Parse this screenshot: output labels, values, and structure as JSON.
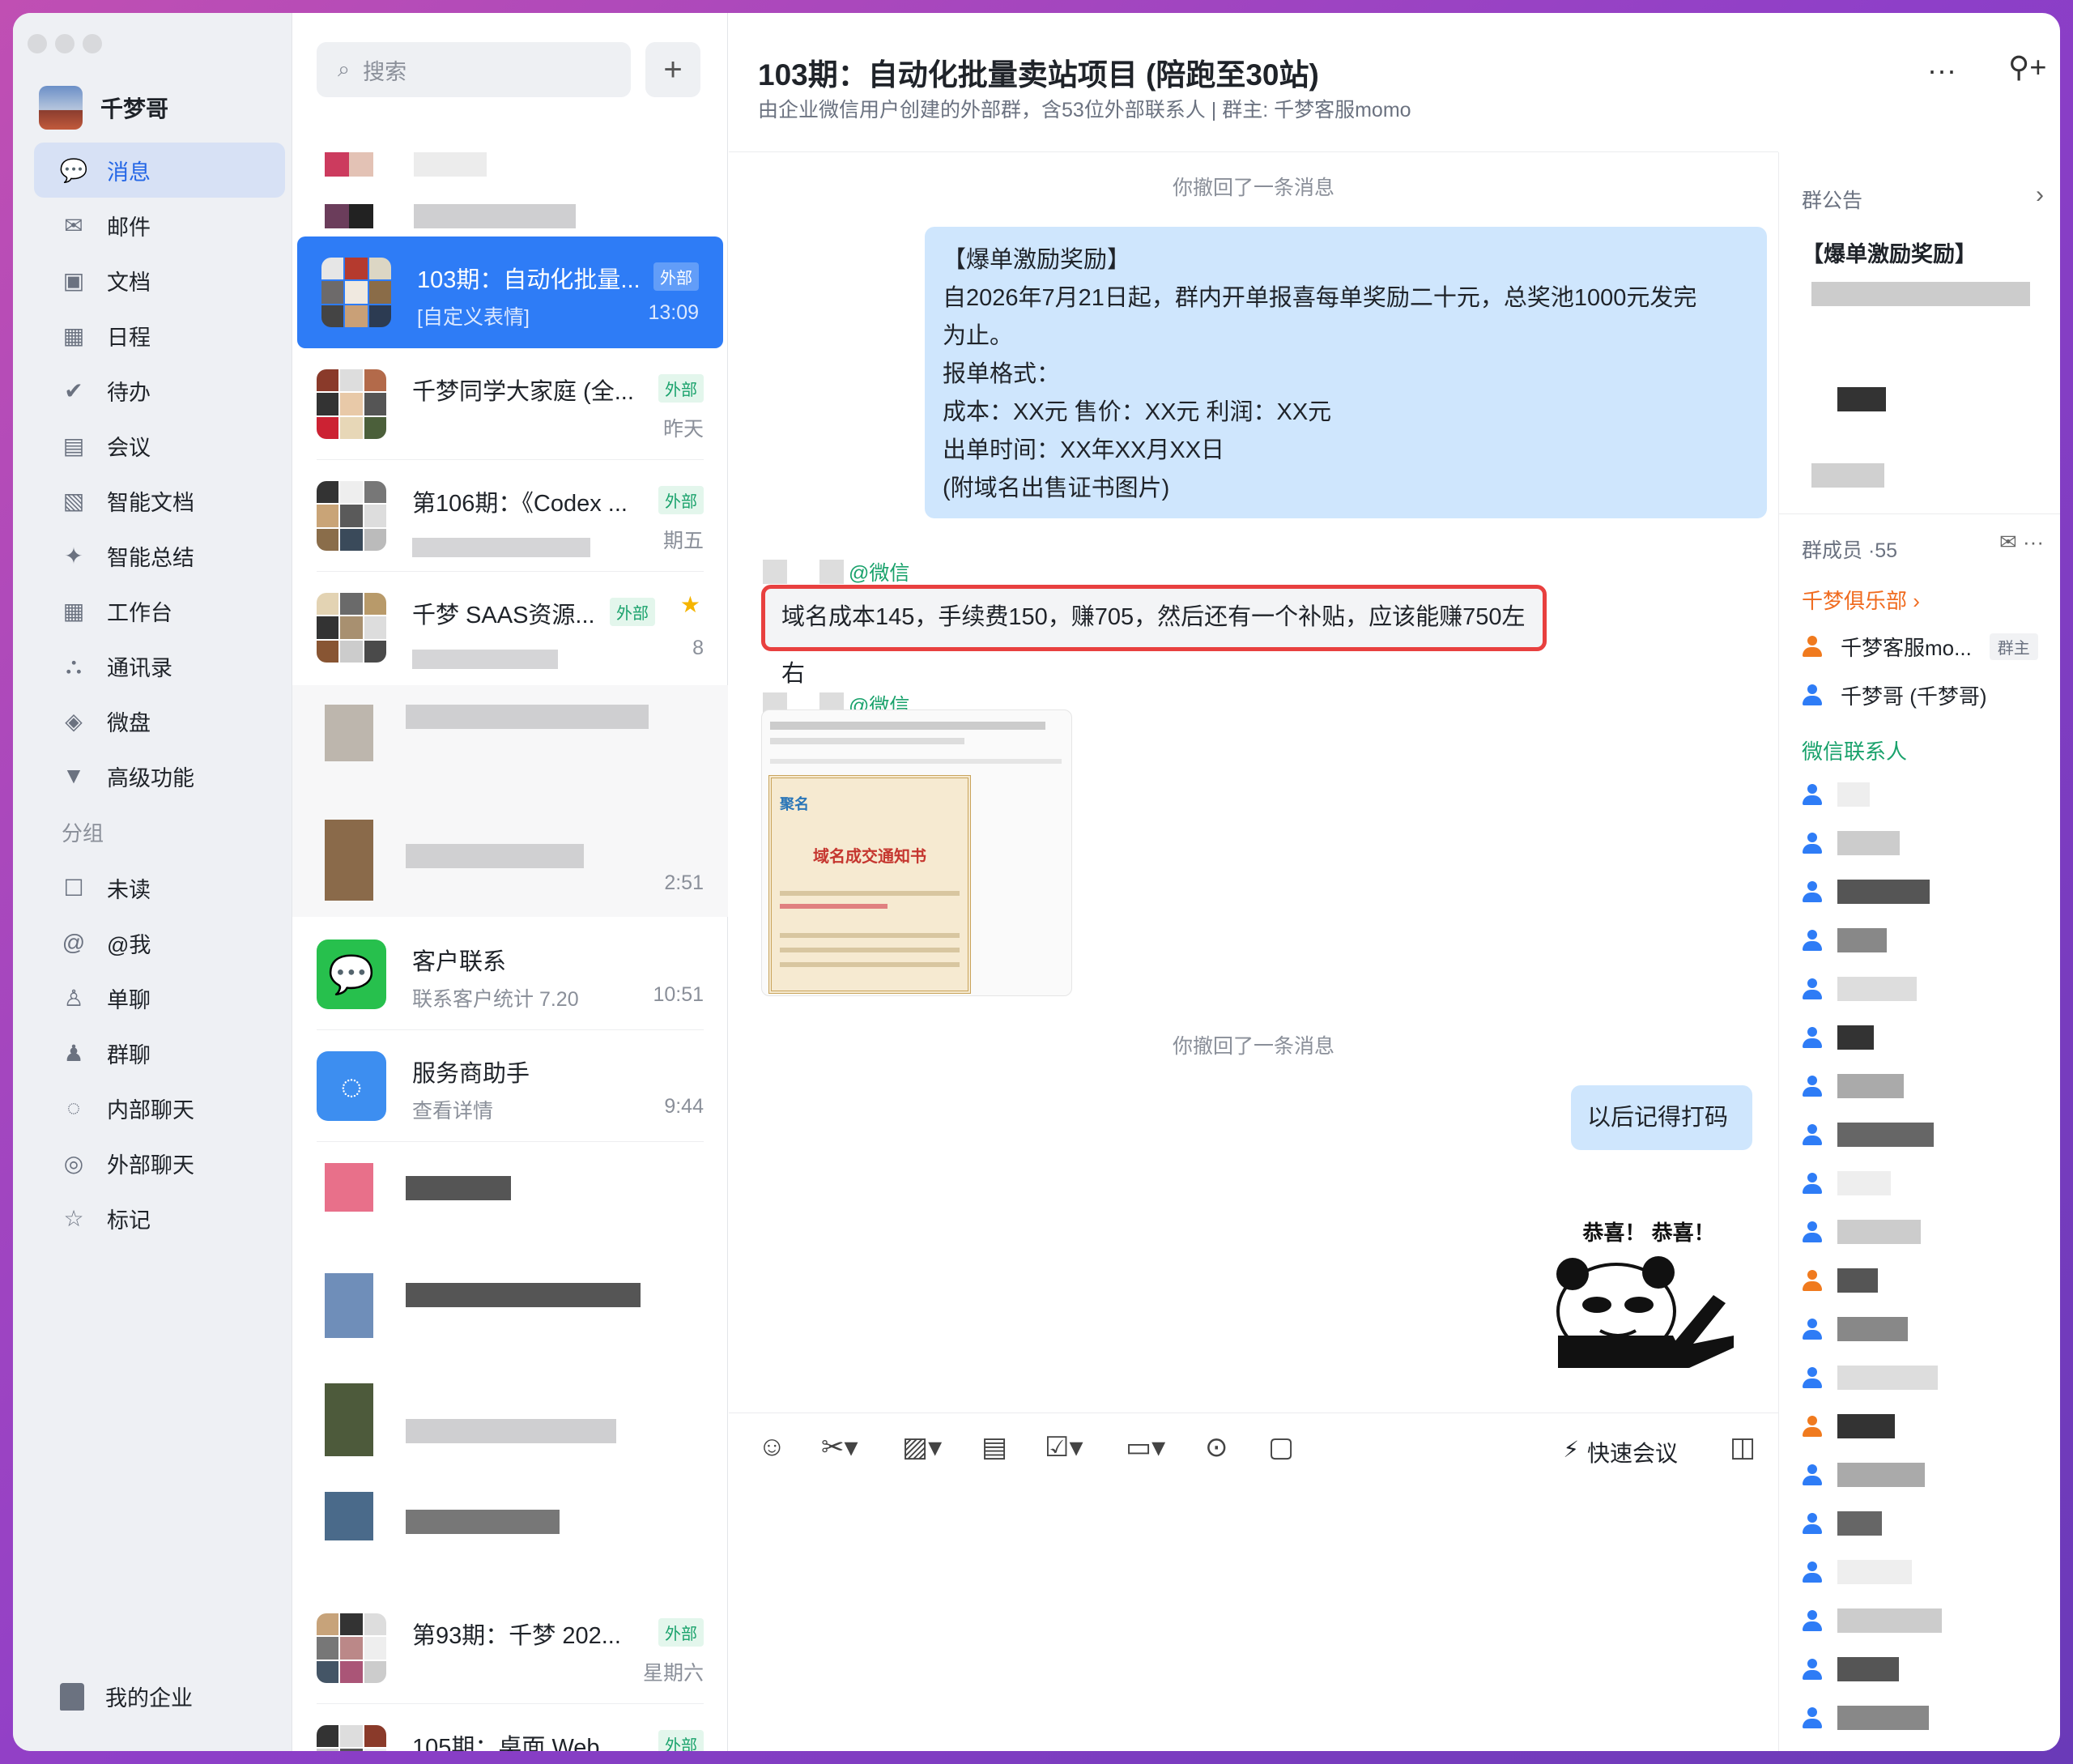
{
  "user": {
    "name": "千梦哥"
  },
  "nav": {
    "items": [
      {
        "label": "消息",
        "icon": "message-icon",
        "active": true
      },
      {
        "label": "邮件",
        "icon": "mail-icon"
      },
      {
        "label": "文档",
        "icon": "doc-icon"
      },
      {
        "label": "日程",
        "icon": "calendar-icon"
      },
      {
        "label": "待办",
        "icon": "todo-icon"
      },
      {
        "label": "会议",
        "icon": "meeting-icon"
      },
      {
        "label": "智能文档",
        "icon": "smart-doc-icon"
      },
      {
        "label": "智能总结",
        "icon": "sparkle-icon"
      },
      {
        "label": "工作台",
        "icon": "grid-icon"
      },
      {
        "label": "通讯录",
        "icon": "contacts-icon"
      },
      {
        "label": "微盘",
        "icon": "drive-icon"
      },
      {
        "label": "高级功能",
        "icon": "advanced-icon"
      }
    ],
    "group_title": "分组",
    "groups": [
      {
        "label": "未读",
        "icon": "unread-icon"
      },
      {
        "label": "@我",
        "icon": "at-icon"
      },
      {
        "label": "单聊",
        "icon": "person-icon"
      },
      {
        "label": "群聊",
        "icon": "group-icon"
      },
      {
        "label": "内部聊天",
        "icon": "internal-chat-icon"
      },
      {
        "label": "外部聊天",
        "icon": "external-chat-icon"
      },
      {
        "label": "标记",
        "icon": "star-icon"
      }
    ],
    "enterprise": "我的企业"
  },
  "search": {
    "placeholder": "搜索"
  },
  "conversations": [
    {
      "title": "103期：自动化批量...",
      "tag": "外部",
      "snippet": "[自定义表情]",
      "time": "13:09"
    },
    {
      "title": "千梦同学大家庭 (全...",
      "tag": "外部",
      "snippet": "",
      "time": "昨天"
    },
    {
      "title": "第106期：《Codex ...",
      "tag": "外部",
      "snippet": "",
      "time": "期五"
    },
    {
      "title": "千梦 SAAS资源...",
      "tag": "外部",
      "snippet": "",
      "time": "8"
    },
    {
      "title": "",
      "tag": "",
      "snippet": "",
      "time": "2:51"
    },
    {
      "title": "客户联系",
      "tag": "",
      "snippet": "联系客户统计 7.20",
      "time": "10:51"
    },
    {
      "title": "服务商助手",
      "tag": "",
      "snippet": "查看详情",
      "time": "9:44"
    },
    {
      "title": "第93期：千梦 202...",
      "tag": "外部",
      "snippet": "",
      "time": "星期六"
    },
    {
      "title": "105期：桌面 Web ...",
      "tag": "外部",
      "snippet": "",
      "time": ""
    }
  ],
  "chat": {
    "title": "103期：自动化批量卖站项目 (陪跑至30站)",
    "subtitle": "由企业微信用户创建的外部群，含53位外部联系人 | 群主: 千梦客服momo",
    "recall_1": "你撤回了一条消息",
    "recall_2": "你撤回了一条消息",
    "notice_lines": [
      "【爆单激励奖励】",
      "自2026年7月21日起，群内开单报喜每单奖励二十元，总奖池1000元发完",
      "为止。",
      "报单格式：",
      "成本：XX元  售价：XX元 利润：XX元",
      "出单时间：XX年XX月XX日",
      "(附域名出售证书图片)"
    ],
    "wx_label": "@微信",
    "highlight_msg": "域名成本145，手续费150，赚705，然后还有一个补贴，应该能赚750左右",
    "cert_brand": "聚名",
    "cert_title": "域名成交通知书",
    "reply": "以后记得打码",
    "sticker_text": "恭喜！ 恭喜！",
    "quick_meeting": "快速会议"
  },
  "panel": {
    "notice_title": "群公告",
    "notice_preview": "【爆单激励奖励】",
    "members_title": "群成员 ·55",
    "club": "千梦俱乐部 ›",
    "members": [
      {
        "name": "千梦客服mo...",
        "badge": "群主",
        "color": "#f07a1e"
      },
      {
        "name": "千梦哥 (千梦哥)",
        "badge": "",
        "color": "#2e7cf6"
      }
    ],
    "wx_contacts": "微信联系人"
  },
  "colors": {
    "accent": "#2e7cf6",
    "external_tag": "#1aa26c",
    "highlight_border": "#e8403f",
    "bubble": "#cfe6fd"
  }
}
